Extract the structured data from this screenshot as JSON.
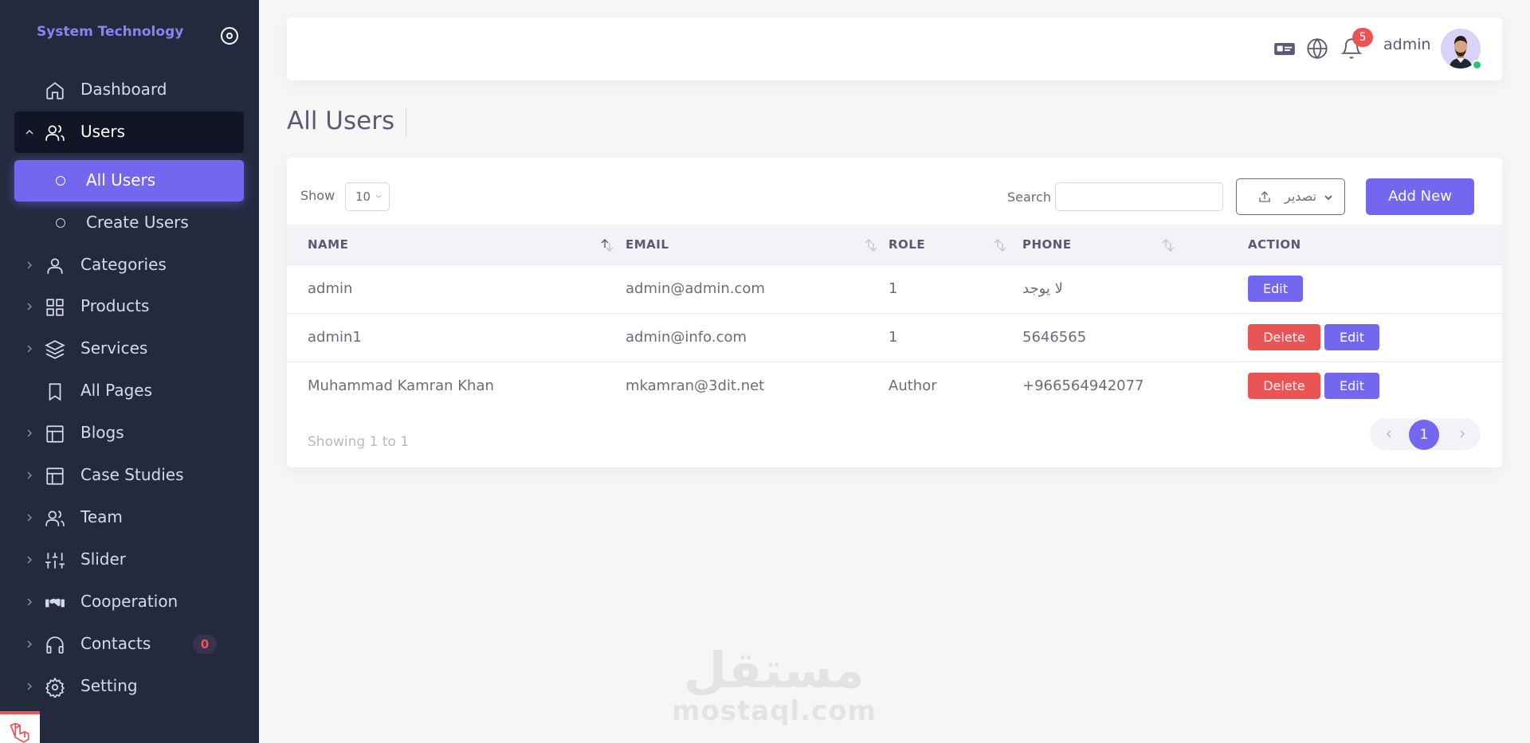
{
  "sidebar": {
    "brand": "System Technology",
    "items": [
      {
        "label": "Dashboard",
        "icon": "home-icon"
      },
      {
        "label": "Users",
        "icon": "users-icon"
      },
      {
        "label": "Categories",
        "icon": "user-icon"
      },
      {
        "label": "Products",
        "icon": "grid-icon"
      },
      {
        "label": "Services",
        "icon": "layers-icon"
      },
      {
        "label": "All Pages",
        "icon": "bookmark-icon"
      },
      {
        "label": "Blogs",
        "icon": "layout-icon"
      },
      {
        "label": "Case Studies",
        "icon": "layout-icon"
      },
      {
        "label": "Team",
        "icon": "users-icon"
      },
      {
        "label": "Slider",
        "icon": "sliders-icon"
      },
      {
        "label": "Cooperation",
        "icon": "handshake-icon"
      },
      {
        "label": "Contacts",
        "icon": "headphones-icon"
      },
      {
        "label": "Setting",
        "icon": "gear-icon"
      }
    ],
    "sub_items": [
      {
        "label": "All Users"
      },
      {
        "label": "Create Users"
      }
    ],
    "contacts_count": "0"
  },
  "topbar": {
    "notification_count": "5",
    "username": "admin"
  },
  "page": {
    "title": "All Users"
  },
  "table_controls": {
    "show_label": "Show",
    "page_size": "10",
    "search_label": "Search",
    "search_value": "",
    "export_label": "تصدير",
    "add_new_label": "Add New"
  },
  "table": {
    "columns": [
      "NAME",
      "EMAIL",
      "ROLE",
      "PHONE",
      "ACTION"
    ],
    "rows": [
      {
        "name": "admin",
        "email": "admin@admin.com",
        "role": "1",
        "phone": "لا يوجد",
        "actions": [
          "Edit"
        ]
      },
      {
        "name": "admin1",
        "email": "admin@info.com",
        "role": "1",
        "phone": "5646565",
        "actions": [
          "Delete",
          "Edit"
        ]
      },
      {
        "name": "Muhammad Kamran Khan",
        "email": "mkamran@3dit.net",
        "role": "Author",
        "phone": "+966564942077",
        "actions": [
          "Delete",
          "Edit"
        ]
      }
    ],
    "delete_label": "Delete",
    "edit_label": "Edit"
  },
  "footer": {
    "showing": "Showing 1 to 1",
    "current_page": "1"
  },
  "watermark": {
    "arabic": "مستقل",
    "latin": "mostaql.com"
  },
  "colors": {
    "primary": "#7367f0",
    "danger": "#ea5455",
    "success": "#28c76f",
    "sidebar_bg": "#242a3e"
  }
}
